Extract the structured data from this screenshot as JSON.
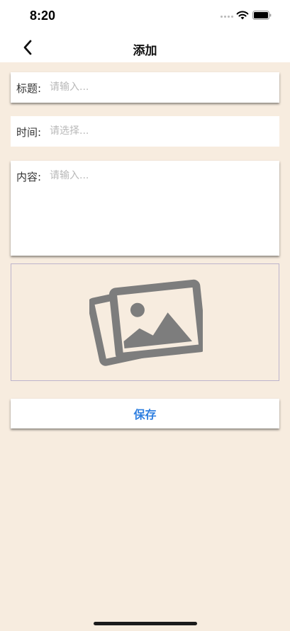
{
  "status_bar": {
    "time": "8:20"
  },
  "nav": {
    "title": "添加",
    "back_icon": "chevron-left-icon"
  },
  "form": {
    "title_field": {
      "label": "标题:",
      "placeholder": "请输入...",
      "value": ""
    },
    "time_field": {
      "label": "时间:",
      "placeholder": "请选择...",
      "value": ""
    },
    "content_field": {
      "label": "内容:",
      "placeholder": "请输入...",
      "value": ""
    }
  },
  "image_picker": {
    "icon": "photos-icon"
  },
  "save_button": {
    "label": "保存"
  },
  "colors": {
    "background": "#f7ecdf",
    "accent": "#2f7fe0",
    "icon_gray": "#7d7d7d"
  }
}
